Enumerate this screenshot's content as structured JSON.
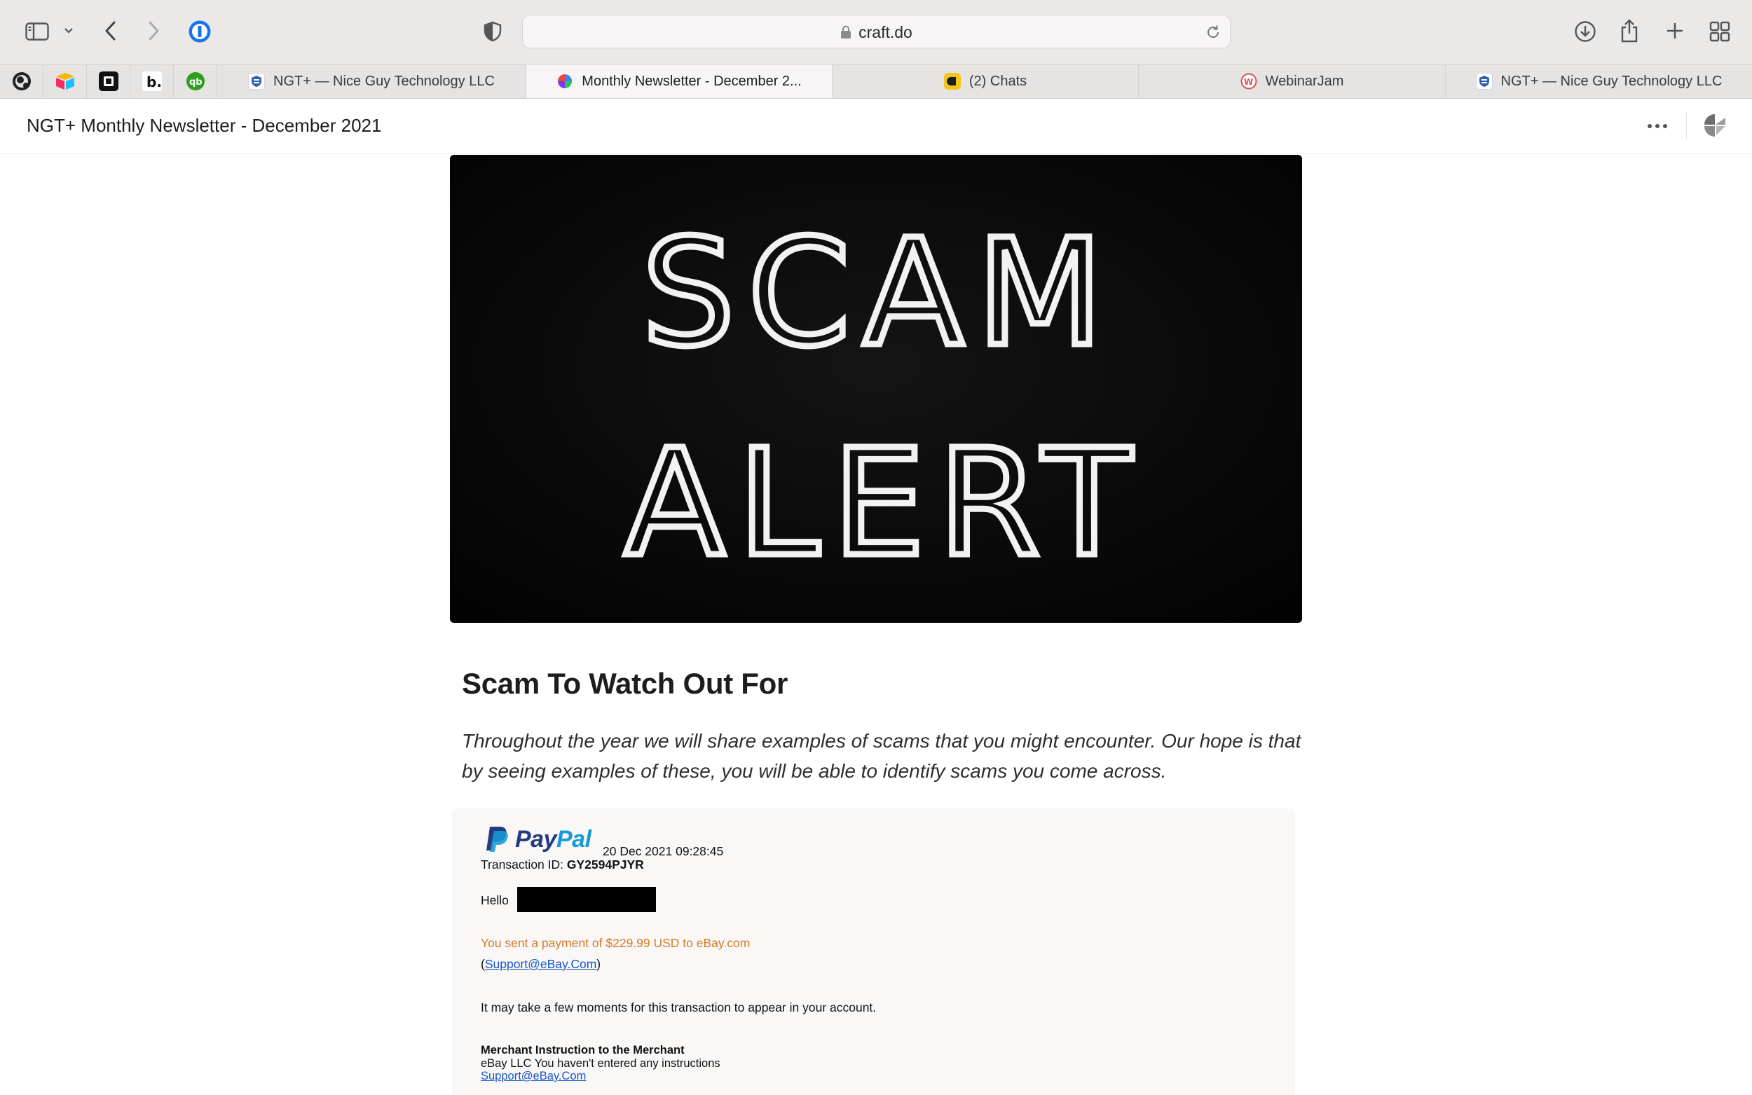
{
  "browser": {
    "url": "craft.do",
    "icons": {
      "sidebar_toggle": "sidebar-icon",
      "sidebar_menu": "chevron-down-icon",
      "back": "chevron-left-icon",
      "forward": "chevron-right-icon",
      "password_manager": "1password-icon",
      "privacy": "shield-icon",
      "lock": "lock-icon",
      "reload": "reload-icon",
      "downloads": "download-icon",
      "share": "share-icon",
      "new_tab": "plus-icon",
      "tab_overview": "grid-icon"
    }
  },
  "pinned_tabs": [
    {
      "name": "mailchimp",
      "icon": "mailchimp-icon"
    },
    {
      "name": "airtable",
      "icon": "airtable-icon"
    },
    {
      "name": "square",
      "icon": "square-icon"
    },
    {
      "name": "b",
      "icon": "b-icon"
    },
    {
      "name": "quickbooks",
      "icon": "quickbooks-icon"
    }
  ],
  "tabs": [
    {
      "label": "NGT+ — Nice Guy Technology LLC",
      "active": false
    },
    {
      "label": "Monthly Newsletter - December 2...",
      "active": true
    },
    {
      "label": "(2) Chats",
      "active": false
    },
    {
      "label": "WebinarJam",
      "active": false
    },
    {
      "label": "NGT+ — Nice Guy Technology LLC",
      "active": false
    }
  ],
  "document": {
    "title": "NGT+ Monthly Newsletter - December 2021",
    "hero_text": [
      "SCAM",
      "ALERT"
    ],
    "heading": "Scam To Watch Out For",
    "intro": "Throughout the year we will share examples of scams that you might encounter. Our hope is that by seeing examples of these, you will be able to identify scams you come across."
  },
  "email": {
    "brand_pay": "Pay",
    "brand_pal": "Pal",
    "date": "20 Dec 2021 09:28:45",
    "transaction_label": "Transaction ID: ",
    "transaction_id": "GY2594PJYR",
    "greeting": "Hello",
    "payment_line": "You sent a payment of $229.99 USD to eBay.com",
    "support_email": "Support@eBay.Com",
    "wait_line": "It may take a few moments for this transaction to appear in your account.",
    "merchant_title": "Merchant Instruction to the Merchant",
    "merchant_body": "eBay LLC You haven't entered any instructions",
    "merchant_link": "Support@eBay.Com"
  },
  "colors": {
    "accent_orange": "#d57a24",
    "link_blue": "#1a56c8",
    "paypal_dark": "#253b80",
    "paypal_light": "#179bd7"
  }
}
